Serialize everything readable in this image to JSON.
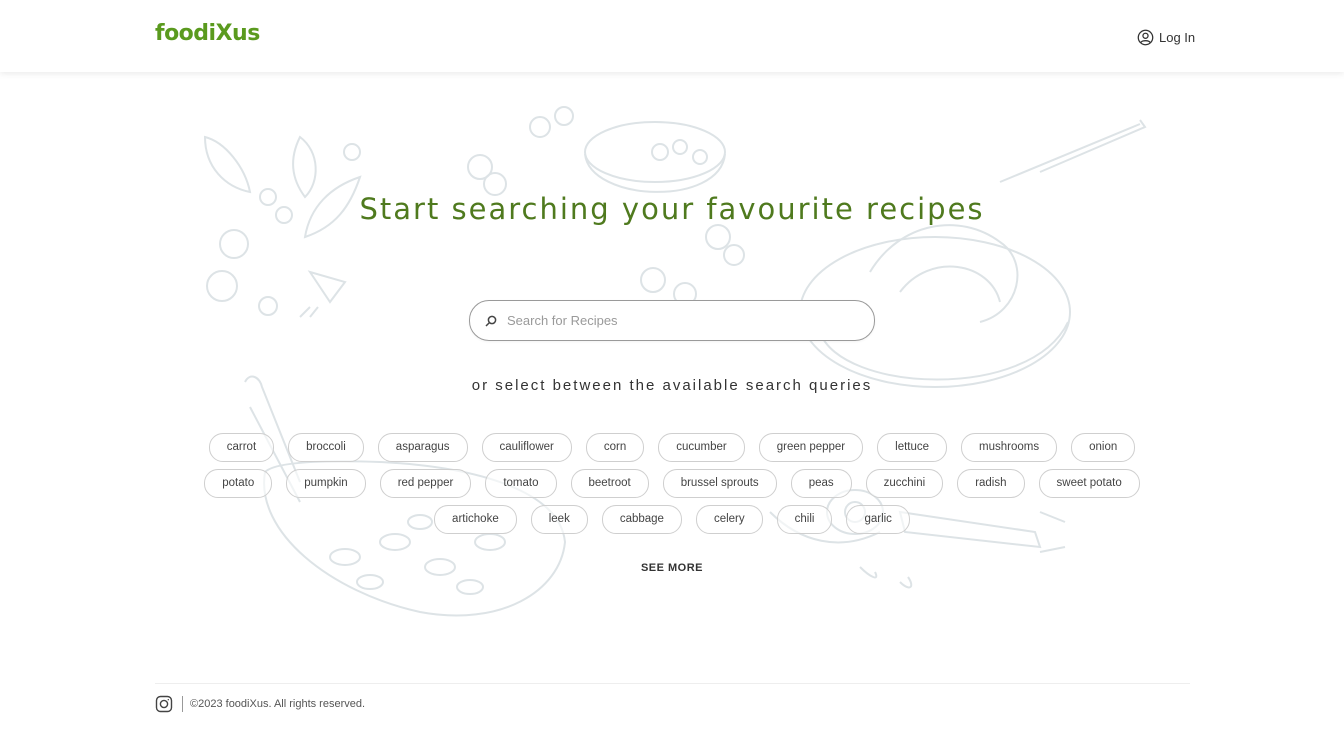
{
  "header": {
    "logo": "foodiXus",
    "login_label": "Log In",
    "login_icon": "user-circle-icon"
  },
  "hero": {
    "title": "Start searching your favourite recipes",
    "search_placeholder": "Search for Recipes",
    "search_icon": "search-icon",
    "subtitle": "or select between the available search queries"
  },
  "tags": [
    "carrot",
    "broccoli",
    "asparagus",
    "cauliflower",
    "corn",
    "cucumber",
    "green pepper",
    "lettuce",
    "mushrooms",
    "onion",
    "potato",
    "pumpkin",
    "red pepper",
    "tomato",
    "beetroot",
    "brussel sprouts",
    "peas",
    "zucchini",
    "radish",
    "sweet potato",
    "artichoke",
    "leek",
    "cabbage",
    "celery",
    "chili",
    "garlic"
  ],
  "see_more_label": "SEE MORE",
  "footer": {
    "social_icon": "instagram-icon",
    "copyright": "©2023 foodiXus. All rights reserved."
  },
  "colors": {
    "brand_green": "#5a9a1e",
    "title_green": "#4f7a1e",
    "illustration": "#dde3e6"
  }
}
